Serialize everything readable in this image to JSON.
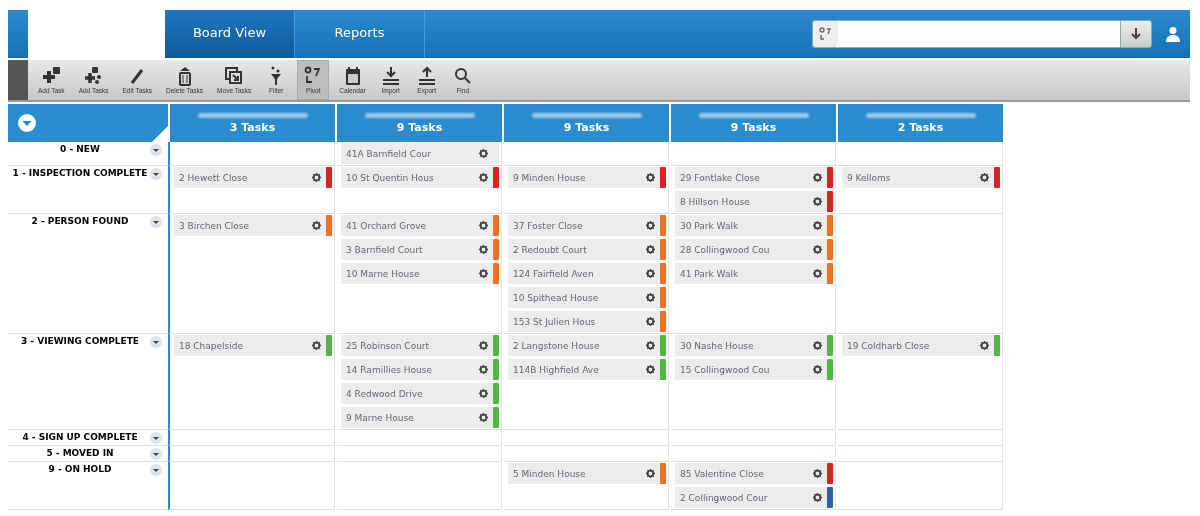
{
  "tabs": [
    {
      "label": "Board View",
      "selected": true
    },
    {
      "label": "Reports",
      "selected": false
    }
  ],
  "toolbar": [
    {
      "label": "Add Task",
      "selected": false
    },
    {
      "label": "Add Tasks",
      "selected": false
    },
    {
      "label": "Edit Tasks",
      "selected": false
    },
    {
      "label": "Delete Tasks",
      "selected": false
    },
    {
      "label": "Move Tasks",
      "selected": false
    },
    {
      "label": "Filter",
      "selected": false
    },
    {
      "label": "Pivot",
      "selected": true
    },
    {
      "label": "Calendar",
      "selected": false
    },
    {
      "label": "Import",
      "selected": false
    },
    {
      "label": "Export",
      "selected": false
    },
    {
      "label": "Find",
      "selected": false
    }
  ],
  "board": {
    "columns": [
      {
        "count": "3 Tasks"
      },
      {
        "count": "9 Tasks"
      },
      {
        "count": "9 Tasks"
      },
      {
        "count": "9 Tasks"
      },
      {
        "count": "2 Tasks"
      }
    ],
    "rows": [
      {
        "label": "0 - NEW",
        "cells": [
          [],
          [
            {
              "title": "41A Barnfield Cour"
            }
          ],
          [],
          [],
          []
        ]
      },
      {
        "label": "1 - INSPECTION COMPLETE",
        "cells": [
          [
            {
              "title": "2 Hewett Close",
              "color": "#e02020"
            }
          ],
          [
            {
              "title": "10 St Quentin Hous",
              "color": "#e02020"
            }
          ],
          [
            {
              "title": "9 Minden House",
              "color": "#e02020"
            }
          ],
          [
            {
              "title": "29 Fontlake Close",
              "color": "#e02020"
            },
            {
              "title": "8 Hillson House",
              "color": "#e02020"
            }
          ],
          [
            {
              "title": "9 Kelloms",
              "color": "#e02020"
            }
          ]
        ]
      },
      {
        "label": "2 - PERSON FOUND",
        "cells": [
          [
            {
              "title": "3 Birchen Close",
              "color": "#f07020"
            }
          ],
          [
            {
              "title": "41 Orchard Grove",
              "color": "#f07020"
            },
            {
              "title": "3 Barnfield Court",
              "color": "#f07020"
            },
            {
              "title": "10 Marne House",
              "color": "#f07020"
            }
          ],
          [
            {
              "title": "37 Foster Close",
              "color": "#f07020"
            },
            {
              "title": "2 Redoubt Court",
              "color": "#f07020"
            },
            {
              "title": "124 Fairfield Aven",
              "color": "#f07020"
            },
            {
              "title": "10 Spithead House",
              "color": "#f07020"
            },
            {
              "title": "153 St Julien Hous",
              "color": "#f07020"
            }
          ],
          [
            {
              "title": "30 Park Walk",
              "color": "#f07020"
            },
            {
              "title": "28 Collingwood Cou",
              "color": "#f07020"
            },
            {
              "title": "41 Park Walk",
              "color": "#f07020"
            }
          ],
          []
        ]
      },
      {
        "label": "3 - VIEWING COMPLETE",
        "cells": [
          [
            {
              "title": "18 Chapelside",
              "color": "#50b840"
            }
          ],
          [
            {
              "title": "25 Robinson Court",
              "color": "#50b840"
            },
            {
              "title": "14 Ramillies House",
              "color": "#50b840"
            },
            {
              "title": "4 Redwood Drive",
              "color": "#50b840"
            },
            {
              "title": "9 Marne House",
              "color": "#50b840"
            }
          ],
          [
            {
              "title": "2 Langstone House",
              "color": "#50b840"
            },
            {
              "title": "114B Highfield Ave",
              "color": "#50b840"
            }
          ],
          [
            {
              "title": "30 Nashe House",
              "color": "#50b840"
            },
            {
              "title": "15 Collingwood Cou",
              "color": "#50b840"
            }
          ],
          [
            {
              "title": "19 Coldharb Close",
              "color": "#50b840"
            }
          ]
        ]
      },
      {
        "label": "4 - SIGN UP COMPLETE",
        "cells": [
          [],
          [],
          [],
          [],
          []
        ]
      },
      {
        "label": "5 - MOVED IN",
        "cells": [
          [],
          [],
          [],
          [],
          []
        ]
      },
      {
        "label": "9 - ON HOLD",
        "cells": [
          [],
          [],
          [
            {
              "title": "5 Minden House",
              "color": "#f07020"
            }
          ],
          [
            {
              "title": "85 Valentine Close",
              "color": "#e02020"
            },
            {
              "title": "2 Collingwood Cour",
              "color": "#3060a0"
            }
          ],
          []
        ]
      }
    ]
  }
}
